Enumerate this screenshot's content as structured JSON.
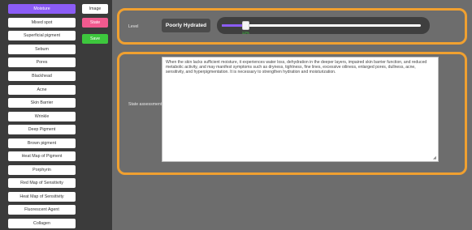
{
  "sidebar": {
    "items": [
      {
        "label": "Moisture",
        "active": true
      },
      {
        "label": "Mixed spot",
        "active": false
      },
      {
        "label": "Superficial pigment",
        "active": false
      },
      {
        "label": "Sebum",
        "active": false
      },
      {
        "label": "Pores",
        "active": false
      },
      {
        "label": "Blackhead",
        "active": false
      },
      {
        "label": "Acne",
        "active": false
      },
      {
        "label": "Skin Barrier",
        "active": false
      },
      {
        "label": "Wrinkle",
        "active": false
      },
      {
        "label": "Deep Pigment",
        "active": false
      },
      {
        "label": "Brown pigment",
        "active": false
      },
      {
        "label": "Heat Map of Pigment",
        "active": false
      },
      {
        "label": "Porphyrin",
        "active": false
      },
      {
        "label": "Red Map of Sensitivity",
        "active": false
      },
      {
        "label": "Heat Map of Sensitivity",
        "active": false
      },
      {
        "label": "Fluorescent Agent",
        "active": false
      },
      {
        "label": "Collagen",
        "active": false
      }
    ]
  },
  "actions": {
    "image_label": "Image",
    "state_label": "State",
    "save_label": "Save"
  },
  "level": {
    "label": "Level",
    "badge": "Poorly Hydrated",
    "value_text": "12%",
    "value_fraction": 0.12
  },
  "state_assessment": {
    "label": "State assessment",
    "text": "When the skin lacks sufficient moisture, it experiences water loss, dehydration in the deeper layers, impaired skin barrier function, and reduced metabolic activity, and may manifest symptoms such as dryness, tightness, fine lines, excessive oiliness, enlarged pores, dullness, acne, sensitivity, and hyperpigmentation. It is necessary to strengthen hydration and moisturization."
  },
  "colors": {
    "accent": "#8b5cf6",
    "panel_border": "#f0a030",
    "state_button": "#f25a8f",
    "save_button": "#3dc73d",
    "value_text": "#3dc73d"
  }
}
